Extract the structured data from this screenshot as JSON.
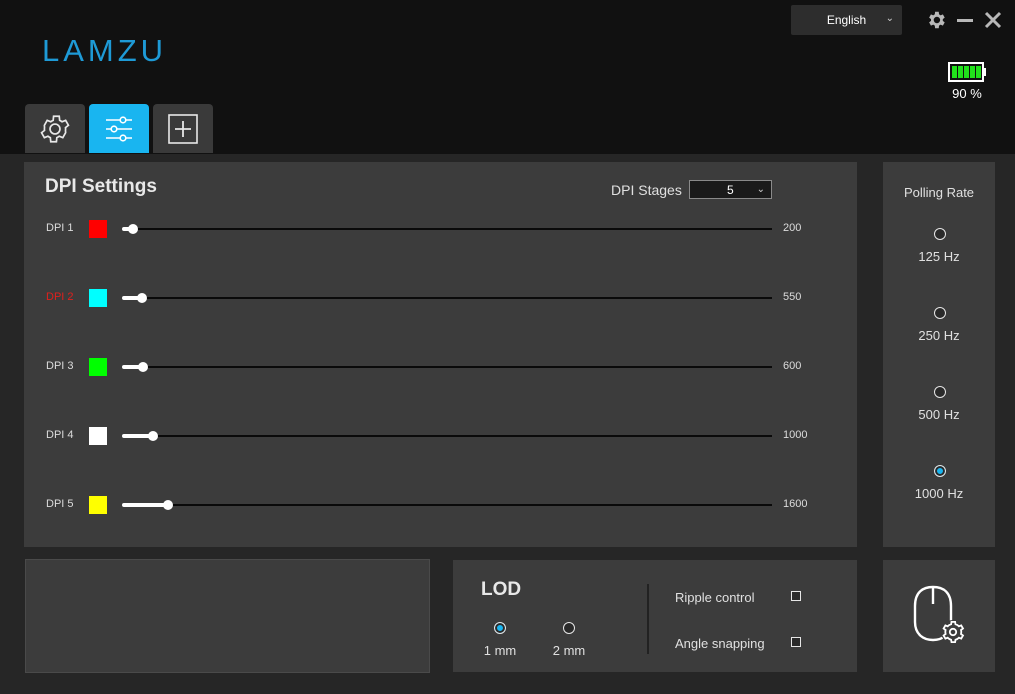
{
  "header": {
    "brand": "LAMZU",
    "language": "English",
    "battery_text": "90 %",
    "battery_level": 0.9,
    "battery_color": "#21e21b"
  },
  "tabs": [
    {
      "name": "general-settings",
      "icon": "gear-icon",
      "active": false
    },
    {
      "name": "performance",
      "icon": "sliders-icon",
      "active": true
    },
    {
      "name": "macro",
      "icon": "plus-box-icon",
      "active": false
    }
  ],
  "dpi": {
    "title": "DPI Settings",
    "stages_label": "DPI Stages",
    "stages_value": "5",
    "selected_index": 1,
    "max_dpi": 26000,
    "stages": [
      {
        "label": "DPI 1",
        "value": "200",
        "color": "#ff0000"
      },
      {
        "label": "DPI 2",
        "value": "550",
        "color": "#00ffff"
      },
      {
        "label": "DPI 3",
        "value": "600",
        "color": "#00ff00"
      },
      {
        "label": "DPI 4",
        "value": "1000",
        "color": "#ffffff"
      },
      {
        "label": "DPI 5",
        "value": "1600",
        "color": "#ffff00"
      }
    ]
  },
  "polling": {
    "title": "Polling Rate",
    "options": [
      {
        "label": "125 Hz",
        "checked": false
      },
      {
        "label": "250 Hz",
        "checked": false
      },
      {
        "label": "500 Hz",
        "checked": false
      },
      {
        "label": "1000 Hz",
        "checked": true
      }
    ]
  },
  "lod": {
    "title": "LOD",
    "options": [
      {
        "label": "1 mm",
        "checked": true
      },
      {
        "label": "2 mm",
        "checked": false
      }
    ],
    "ripple_label": "Ripple control",
    "ripple_checked": false,
    "angle_label": "Angle snapping",
    "angle_checked": false
  },
  "accent_color": "#19b5f0"
}
